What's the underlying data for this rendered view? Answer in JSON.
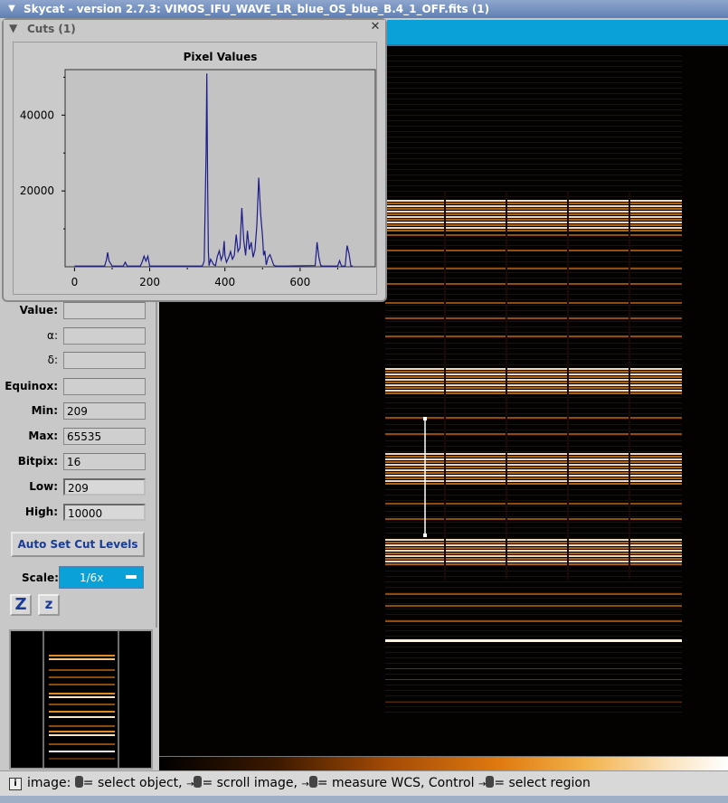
{
  "window": {
    "title": "Skycat - version 2.7.3: VIMOS_IFU_WAVE_LR_blue_OS_blue_B.4_1_OFF.fits (1)",
    "icon": "chevron-down-icon"
  },
  "cuts_dialog": {
    "title": "Cuts (1)",
    "collapse_icon": "chevron-down-icon",
    "close_icon": "close-icon"
  },
  "chart_data": {
    "type": "line",
    "title": "Pixel Values",
    "xlabel": "",
    "ylabel": "",
    "xlim": [
      -25,
      800
    ],
    "ylim": [
      0,
      52000
    ],
    "x_ticks": [
      0,
      200,
      400,
      600
    ],
    "y_ticks": [
      20000,
      40000
    ],
    "line_color": "#1c1c8a",
    "series": [
      {
        "x": [
          0,
          80,
          85,
          88,
          92,
          100,
          130,
          135,
          140,
          175,
          180,
          185,
          190,
          195,
          200,
          340,
          345,
          350,
          352,
          354,
          356,
          358,
          362,
          370,
          375,
          380,
          385,
          390,
          395,
          398,
          400,
          404,
          410,
          415,
          420,
          425,
          430,
          435,
          440,
          445,
          450,
          455,
          460,
          465,
          470,
          475,
          480,
          485,
          490,
          495,
          500,
          503,
          506,
          510,
          515,
          520,
          530,
          535,
          540,
          545,
          550,
          560,
          640,
          645,
          650,
          655,
          660,
          700,
          705,
          710,
          720,
          725,
          730,
          735,
          740
        ],
        "y": [
          200,
          200,
          1800,
          3800,
          1500,
          200,
          200,
          1200,
          200,
          200,
          1300,
          2800,
          1500,
          2800,
          200,
          200,
          1500,
          30000,
          51000,
          22000,
          4000,
          300,
          2000,
          600,
          300,
          2800,
          4200,
          1800,
          3200,
          6800,
          3000,
          1200,
          2500,
          4000,
          2000,
          3000,
          8500,
          4000,
          5000,
          15500,
          7000,
          3000,
          9500,
          4500,
          6500,
          2500,
          4500,
          11000,
          23500,
          14000,
          8000,
          3000,
          4200,
          500,
          2500,
          3200,
          400,
          200,
          200,
          200,
          200,
          200,
          300,
          6500,
          2500,
          300,
          200,
          200,
          1600,
          200,
          200,
          5600,
          3500,
          200,
          200
        ]
      }
    ]
  },
  "fields": {
    "value": {
      "label": "Value:",
      "value": ""
    },
    "alpha": {
      "label": "α:",
      "value": ""
    },
    "delta": {
      "label": "δ:",
      "value": ""
    },
    "equinox": {
      "label": "Equinox:",
      "value": ""
    },
    "min": {
      "label": "Min:",
      "value": "209"
    },
    "max": {
      "label": "Max:",
      "value": "65535"
    },
    "bitpix": {
      "label": "Bitpix:",
      "value": "16"
    },
    "low": {
      "label": "Low:",
      "value": "209"
    },
    "high": {
      "label": "High:",
      "value": "10000"
    }
  },
  "controls": {
    "auto_cut_label": "Auto Set Cut Levels",
    "scale_label": "Scale:",
    "scale_value": "1/6x",
    "zoom_in_label": "Z",
    "zoom_out_label": "z"
  },
  "status": {
    "info_icon": "info-icon",
    "prefix": "image:",
    "parts": [
      "= select object,",
      "= scroll image,",
      "= measure WCS, Control",
      "= select region"
    ]
  },
  "colors": {
    "accent": "#0aa0d8",
    "title_bar": "#6f8dbd",
    "image_bg": "#040201"
  }
}
